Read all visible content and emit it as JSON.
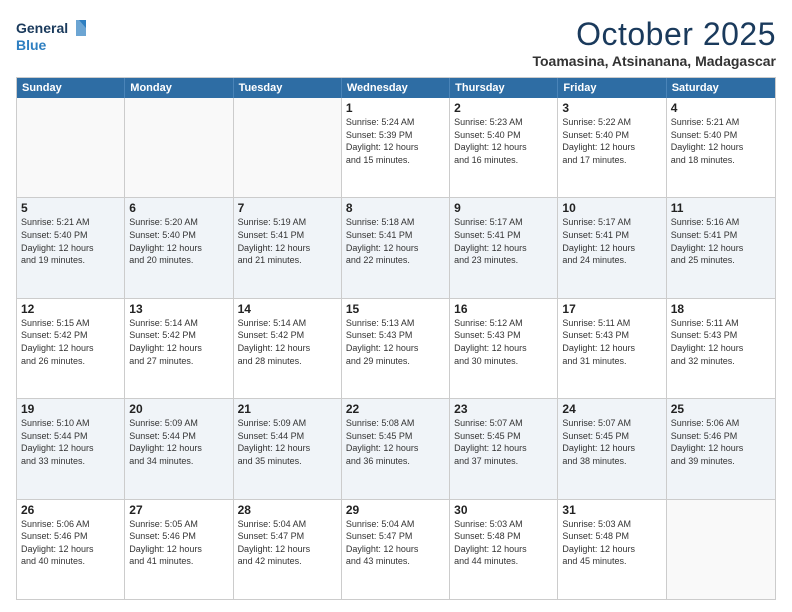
{
  "logo": {
    "line1": "General",
    "line2": "Blue",
    "icon_color": "#2e7fc1"
  },
  "header": {
    "month": "October 2025",
    "location": "Toamasina, Atsinanana, Madagascar"
  },
  "weekdays": [
    "Sunday",
    "Monday",
    "Tuesday",
    "Wednesday",
    "Thursday",
    "Friday",
    "Saturday"
  ],
  "rows": [
    {
      "shaded": false,
      "cells": [
        {
          "day": "",
          "info": ""
        },
        {
          "day": "",
          "info": ""
        },
        {
          "day": "",
          "info": ""
        },
        {
          "day": "1",
          "info": "Sunrise: 5:24 AM\nSunset: 5:39 PM\nDaylight: 12 hours\nand 15 minutes."
        },
        {
          "day": "2",
          "info": "Sunrise: 5:23 AM\nSunset: 5:40 PM\nDaylight: 12 hours\nand 16 minutes."
        },
        {
          "day": "3",
          "info": "Sunrise: 5:22 AM\nSunset: 5:40 PM\nDaylight: 12 hours\nand 17 minutes."
        },
        {
          "day": "4",
          "info": "Sunrise: 5:21 AM\nSunset: 5:40 PM\nDaylight: 12 hours\nand 18 minutes."
        }
      ]
    },
    {
      "shaded": true,
      "cells": [
        {
          "day": "5",
          "info": "Sunrise: 5:21 AM\nSunset: 5:40 PM\nDaylight: 12 hours\nand 19 minutes."
        },
        {
          "day": "6",
          "info": "Sunrise: 5:20 AM\nSunset: 5:40 PM\nDaylight: 12 hours\nand 20 minutes."
        },
        {
          "day": "7",
          "info": "Sunrise: 5:19 AM\nSunset: 5:41 PM\nDaylight: 12 hours\nand 21 minutes."
        },
        {
          "day": "8",
          "info": "Sunrise: 5:18 AM\nSunset: 5:41 PM\nDaylight: 12 hours\nand 22 minutes."
        },
        {
          "day": "9",
          "info": "Sunrise: 5:17 AM\nSunset: 5:41 PM\nDaylight: 12 hours\nand 23 minutes."
        },
        {
          "day": "10",
          "info": "Sunrise: 5:17 AM\nSunset: 5:41 PM\nDaylight: 12 hours\nand 24 minutes."
        },
        {
          "day": "11",
          "info": "Sunrise: 5:16 AM\nSunset: 5:41 PM\nDaylight: 12 hours\nand 25 minutes."
        }
      ]
    },
    {
      "shaded": false,
      "cells": [
        {
          "day": "12",
          "info": "Sunrise: 5:15 AM\nSunset: 5:42 PM\nDaylight: 12 hours\nand 26 minutes."
        },
        {
          "day": "13",
          "info": "Sunrise: 5:14 AM\nSunset: 5:42 PM\nDaylight: 12 hours\nand 27 minutes."
        },
        {
          "day": "14",
          "info": "Sunrise: 5:14 AM\nSunset: 5:42 PM\nDaylight: 12 hours\nand 28 minutes."
        },
        {
          "day": "15",
          "info": "Sunrise: 5:13 AM\nSunset: 5:43 PM\nDaylight: 12 hours\nand 29 minutes."
        },
        {
          "day": "16",
          "info": "Sunrise: 5:12 AM\nSunset: 5:43 PM\nDaylight: 12 hours\nand 30 minutes."
        },
        {
          "day": "17",
          "info": "Sunrise: 5:11 AM\nSunset: 5:43 PM\nDaylight: 12 hours\nand 31 minutes."
        },
        {
          "day": "18",
          "info": "Sunrise: 5:11 AM\nSunset: 5:43 PM\nDaylight: 12 hours\nand 32 minutes."
        }
      ]
    },
    {
      "shaded": true,
      "cells": [
        {
          "day": "19",
          "info": "Sunrise: 5:10 AM\nSunset: 5:44 PM\nDaylight: 12 hours\nand 33 minutes."
        },
        {
          "day": "20",
          "info": "Sunrise: 5:09 AM\nSunset: 5:44 PM\nDaylight: 12 hours\nand 34 minutes."
        },
        {
          "day": "21",
          "info": "Sunrise: 5:09 AM\nSunset: 5:44 PM\nDaylight: 12 hours\nand 35 minutes."
        },
        {
          "day": "22",
          "info": "Sunrise: 5:08 AM\nSunset: 5:45 PM\nDaylight: 12 hours\nand 36 minutes."
        },
        {
          "day": "23",
          "info": "Sunrise: 5:07 AM\nSunset: 5:45 PM\nDaylight: 12 hours\nand 37 minutes."
        },
        {
          "day": "24",
          "info": "Sunrise: 5:07 AM\nSunset: 5:45 PM\nDaylight: 12 hours\nand 38 minutes."
        },
        {
          "day": "25",
          "info": "Sunrise: 5:06 AM\nSunset: 5:46 PM\nDaylight: 12 hours\nand 39 minutes."
        }
      ]
    },
    {
      "shaded": false,
      "cells": [
        {
          "day": "26",
          "info": "Sunrise: 5:06 AM\nSunset: 5:46 PM\nDaylight: 12 hours\nand 40 minutes."
        },
        {
          "day": "27",
          "info": "Sunrise: 5:05 AM\nSunset: 5:46 PM\nDaylight: 12 hours\nand 41 minutes."
        },
        {
          "day": "28",
          "info": "Sunrise: 5:04 AM\nSunset: 5:47 PM\nDaylight: 12 hours\nand 42 minutes."
        },
        {
          "day": "29",
          "info": "Sunrise: 5:04 AM\nSunset: 5:47 PM\nDaylight: 12 hours\nand 43 minutes."
        },
        {
          "day": "30",
          "info": "Sunrise: 5:03 AM\nSunset: 5:48 PM\nDaylight: 12 hours\nand 44 minutes."
        },
        {
          "day": "31",
          "info": "Sunrise: 5:03 AM\nSunset: 5:48 PM\nDaylight: 12 hours\nand 45 minutes."
        },
        {
          "day": "",
          "info": ""
        }
      ]
    }
  ]
}
